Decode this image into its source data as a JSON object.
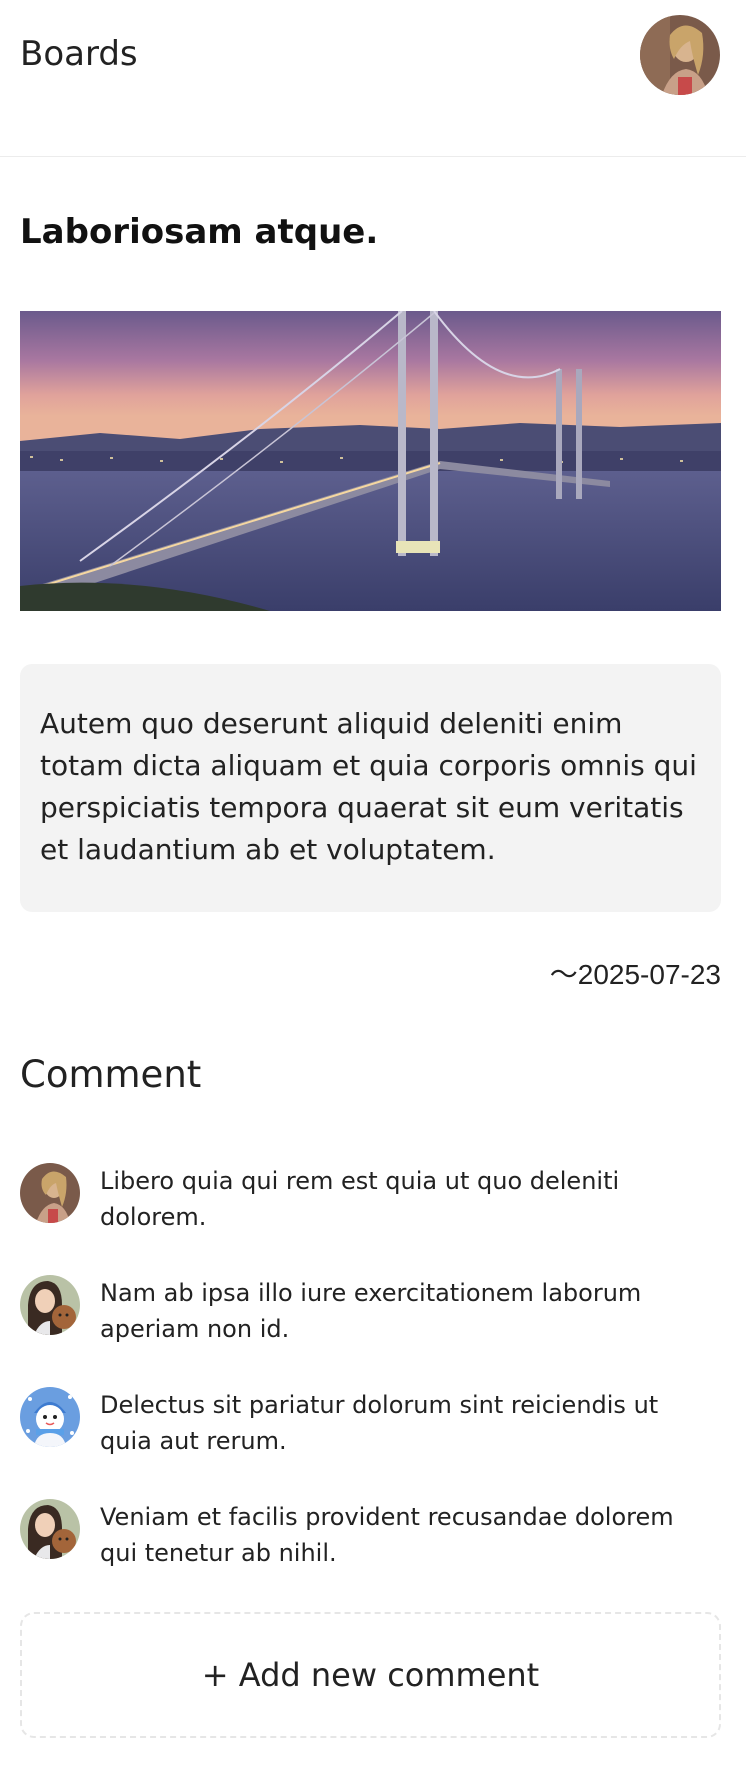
{
  "header": {
    "title": "Boards",
    "avatar": "user-avatar-woman"
  },
  "post": {
    "title": "Laboriosam atque.",
    "image": "suspension-bridge-at-dusk",
    "body": "Autem quo deserunt aliquid deleniti enim totam dicta aliquam et quia corporis omnis qui perspiciatis tempora quaerat sit eum veritatis et laudantium ab et voluptatem.",
    "date": "～2025-07-23"
  },
  "comments": {
    "heading": "Comment",
    "items": [
      {
        "avatar": "woman-portrait-avatar",
        "text": "Libero quia qui rem est quia ut quo deleniti dolorem."
      },
      {
        "avatar": "woman-with-dog-avatar",
        "text": "Nam ab ipsa illo iure exercitationem laborum aperiam non id."
      },
      {
        "avatar": "snowman-avatar",
        "text": "Delectus sit pariatur dolorum sint reiciendis ut quia aut rerum."
      },
      {
        "avatar": "woman-with-dog-avatar",
        "text": "Veniam et facilis provident recusandae dolorem qui tenetur ab nihil."
      }
    ],
    "add_label": "+ Add new comment"
  },
  "colors": {
    "background": "#ffffff",
    "card": "#f3f3f3",
    "divider": "#ececec",
    "text": "#222222"
  }
}
